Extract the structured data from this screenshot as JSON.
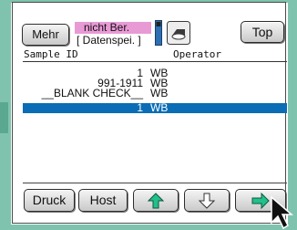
{
  "toolbar": {
    "mehr_label": "Mehr",
    "status_line1": "nicht Ber.",
    "status_line2": "[ Datenspei. ]",
    "top_label": "Top"
  },
  "table": {
    "columns": [
      "Sample ID",
      "Operator"
    ],
    "rows": [
      {
        "id": "1",
        "operator": "WB",
        "selected": false
      },
      {
        "id": "991-1911",
        "operator": "WB",
        "selected": false
      },
      {
        "id": "__BLANK CHECK__",
        "operator": "WB",
        "selected": false
      },
      {
        "id": "1",
        "operator": "WB",
        "selected": true
      }
    ]
  },
  "bottom_bar": {
    "druck_label": "Druck",
    "host_label": "Host",
    "up_icon": "arrow-up-icon",
    "down_icon": "arrow-down-icon",
    "right_icon": "arrow-right-icon"
  },
  "colors": {
    "frame": "#7fc3ae",
    "status_highlight": "#e89ad5",
    "selection": "#0a6db5",
    "arrow_green": "#22c08a"
  }
}
